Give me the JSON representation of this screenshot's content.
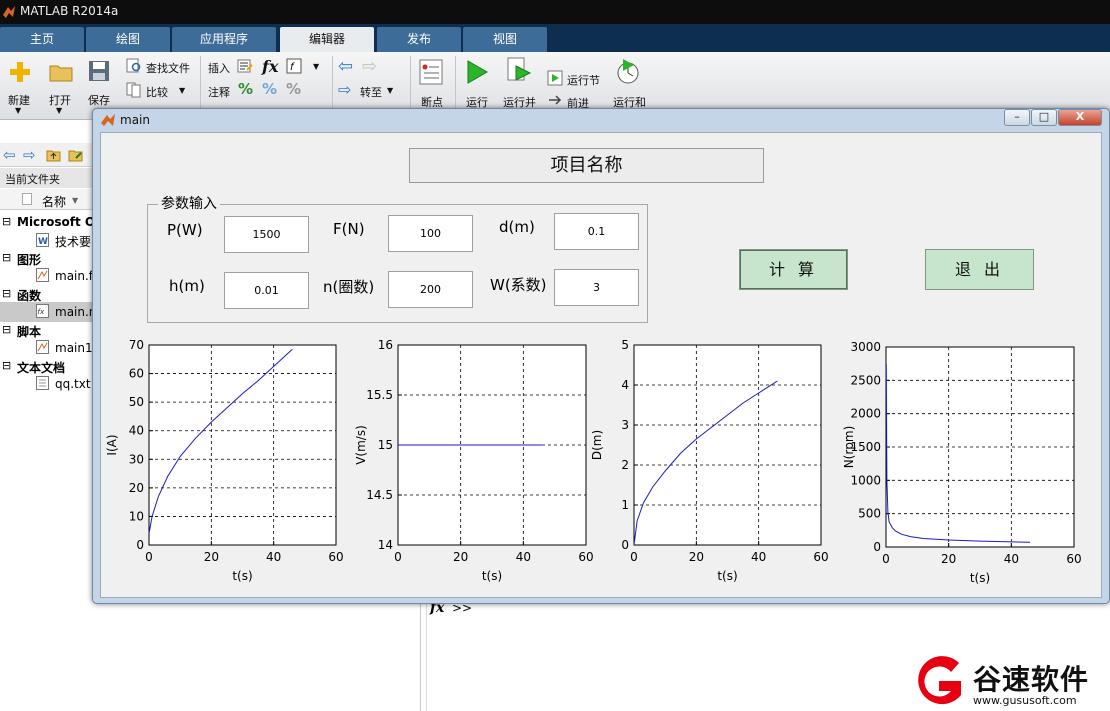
{
  "app": {
    "title": "MATLAB R2014a"
  },
  "tabs": [
    {
      "label": "主页",
      "active": false
    },
    {
      "label": "绘图",
      "active": false
    },
    {
      "label": "应用程序",
      "active": false
    },
    {
      "label": "编辑器",
      "active": true
    },
    {
      "label": "发布",
      "active": false
    },
    {
      "label": "视图",
      "active": false
    }
  ],
  "ribbon": {
    "new": "新建",
    "open": "打开",
    "save": "保存",
    "find_files": "查找文件",
    "compare": "比较",
    "insert": "插入",
    "comment": "注释",
    "goto": "转至",
    "breakpoints": "断点",
    "run": "运行",
    "run_advance": "运行并",
    "run_section": "运行节",
    "advance": "前进",
    "run_time": "运行和"
  },
  "filebrowser": {
    "current_folder": "当前文件夹",
    "name_header": "名称",
    "groups": [
      {
        "label": "Microsoft Of",
        "items": [
          "技术要"
        ]
      },
      {
        "label": "图形",
        "items": [
          "main.fi"
        ]
      },
      {
        "label": "函数",
        "items": [
          "main.m"
        ]
      },
      {
        "label": "脚本",
        "items": [
          "main1"
        ]
      },
      {
        "label": "文本文档",
        "items": [
          "qq.txt"
        ]
      }
    ]
  },
  "command": {
    "prompt": ">>"
  },
  "window": {
    "title": "main",
    "minimize": "–",
    "maximize": "□",
    "close": "X"
  },
  "form": {
    "project_title": "项目名称",
    "group_title": "参数输入",
    "params": [
      {
        "label": "P(W)",
        "value": "1500"
      },
      {
        "label": "F(N)",
        "value": "100"
      },
      {
        "label": "d(m)",
        "value": "0.1"
      },
      {
        "label": "h(m)",
        "value": "0.01"
      },
      {
        "label": "n(圈数)",
        "value": "200"
      },
      {
        "label": "W(系数)",
        "value": "3"
      }
    ],
    "calc_button": "计 算",
    "exit_button": "退 出"
  },
  "chart_data": [
    {
      "type": "line",
      "xlabel": "t(s)",
      "ylabel": "I(A)",
      "xlim": [
        0,
        60
      ],
      "ylim": [
        0,
        70
      ],
      "xticks": [
        0,
        20,
        40,
        60
      ],
      "yticks": [
        0,
        10,
        20,
        30,
        40,
        50,
        60,
        70
      ],
      "grid": true,
      "series": [
        {
          "x": [
            0,
            1,
            3,
            6,
            10,
            15,
            20,
            25,
            30,
            35,
            40,
            46
          ],
          "y": [
            4,
            10,
            17,
            24,
            31,
            37.5,
            43,
            48,
            53,
            57.5,
            62.5,
            68.5
          ],
          "color": "#1a1acc"
        }
      ]
    },
    {
      "type": "line",
      "xlabel": "t(s)",
      "ylabel": "V(m/s)",
      "xlim": [
        0,
        60
      ],
      "ylim": [
        14,
        16
      ],
      "xticks": [
        0,
        20,
        40,
        60
      ],
      "yticks": [
        14,
        14.5,
        15,
        15.5,
        16
      ],
      "grid": true,
      "series": [
        {
          "x": [
            0,
            46
          ],
          "y": [
            15,
            15
          ],
          "color": "#1a1acc"
        }
      ]
    },
    {
      "type": "line",
      "xlabel": "t(s)",
      "ylabel": "D(m)",
      "xlim": [
        0,
        60
      ],
      "ylim": [
        0,
        5
      ],
      "xticks": [
        0,
        20,
        40,
        60
      ],
      "yticks": [
        0,
        1,
        2,
        3,
        4,
        5
      ],
      "grid": true,
      "series": [
        {
          "x": [
            0,
            1,
            3,
            6,
            10,
            15,
            20,
            25,
            30,
            35,
            40,
            46
          ],
          "y": [
            0,
            0.6,
            1.05,
            1.45,
            1.85,
            2.3,
            2.65,
            2.95,
            3.25,
            3.55,
            3.8,
            4.1
          ],
          "color": "#1a1acc"
        }
      ]
    },
    {
      "type": "line",
      "xlabel": "t(s)",
      "ylabel": "N(rpm)",
      "xlim": [
        0,
        60
      ],
      "ylim": [
        0,
        3000
      ],
      "xticks": [
        0,
        20,
        40,
        60
      ],
      "yticks": [
        0,
        500,
        1000,
        1500,
        2000,
        2500,
        3000
      ],
      "grid": true,
      "series": [
        {
          "x": [
            0.1,
            0.3,
            0.6,
            1,
            2,
            3,
            5,
            8,
            12,
            20,
            30,
            46
          ],
          "y": [
            2750,
            1000,
            520,
            380,
            290,
            240,
            190,
            155,
            128,
            105,
            88,
            70
          ],
          "color": "#1a1acc"
        }
      ]
    }
  ],
  "brand": {
    "name": "谷速软件",
    "url": "www.gususoft.com",
    "color": "#e60012"
  }
}
